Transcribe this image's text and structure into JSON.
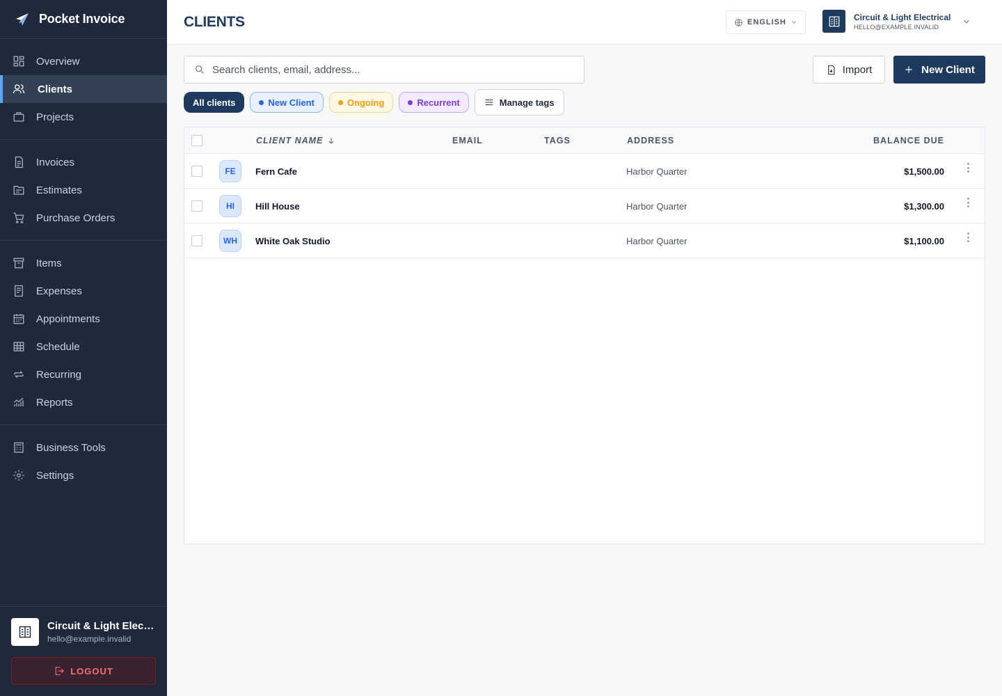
{
  "app": {
    "name": "Pocket Invoice"
  },
  "sidebar": {
    "groups": [
      [
        {
          "label": "Overview",
          "icon": "grid-icon"
        },
        {
          "label": "Clients",
          "icon": "users-icon",
          "active": true
        },
        {
          "label": "Projects",
          "icon": "briefcase-icon"
        }
      ],
      [
        {
          "label": "Invoices",
          "icon": "document-icon"
        },
        {
          "label": "Estimates",
          "icon": "folder-icon"
        },
        {
          "label": "Purchase Orders",
          "icon": "cart-icon"
        }
      ],
      [
        {
          "label": "Items",
          "icon": "box-icon"
        },
        {
          "label": "Expenses",
          "icon": "receipt-icon"
        },
        {
          "label": "Appointments",
          "icon": "calendar-icon"
        },
        {
          "label": "Schedule",
          "icon": "table-icon"
        },
        {
          "label": "Recurring",
          "icon": "repeat-icon"
        },
        {
          "label": "Reports",
          "icon": "chart-icon"
        }
      ],
      [
        {
          "label": "Business Tools",
          "icon": "calculator-icon"
        },
        {
          "label": "Settings",
          "icon": "gear-icon"
        }
      ]
    ],
    "account": {
      "name": "Circuit & Light Electrical",
      "email": "hello@example.invalid"
    },
    "logout_label": "LOGOUT"
  },
  "header": {
    "title": "CLIENTS",
    "language": "ENGLISH",
    "business_name": "Circuit & Light Electrical",
    "business_email": "HELLO@EXAMPLE.INVALID"
  },
  "toolbar": {
    "search_placeholder": "Search clients, email, address...",
    "import_label": "Import",
    "new_client_label": "New Client"
  },
  "filters": {
    "all": "All clients",
    "new": "New Client",
    "ongoing": "Ongoing",
    "recurrent": "Recurrent",
    "manage": "Manage tags"
  },
  "table": {
    "columns": {
      "name": "CLIENT NAME",
      "email": "EMAIL",
      "tags": "TAGS",
      "address": "ADDRESS",
      "balance": "BALANCE DUE"
    },
    "rows": [
      {
        "initials": "FE",
        "name": "Fern Cafe",
        "email": "",
        "tags": "",
        "address": "Harbor Quarter",
        "balance": "$1,500.00"
      },
      {
        "initials": "HI",
        "name": "Hill House",
        "email": "",
        "tags": "",
        "address": "Harbor Quarter",
        "balance": "$1,300.00"
      },
      {
        "initials": "WH",
        "name": "White Oak Studio",
        "email": "",
        "tags": "",
        "address": "Harbor Quarter",
        "balance": "$1,100.00"
      }
    ]
  },
  "colors": {
    "sidebar_bg": "#1e293b",
    "primary": "#1e3a5f",
    "active_indicator": "#60a5fa",
    "new_tag": "#2563eb",
    "ongoing_tag": "#f59e0b",
    "recurrent_tag": "#7e3ad4",
    "logout": "#f87171"
  }
}
